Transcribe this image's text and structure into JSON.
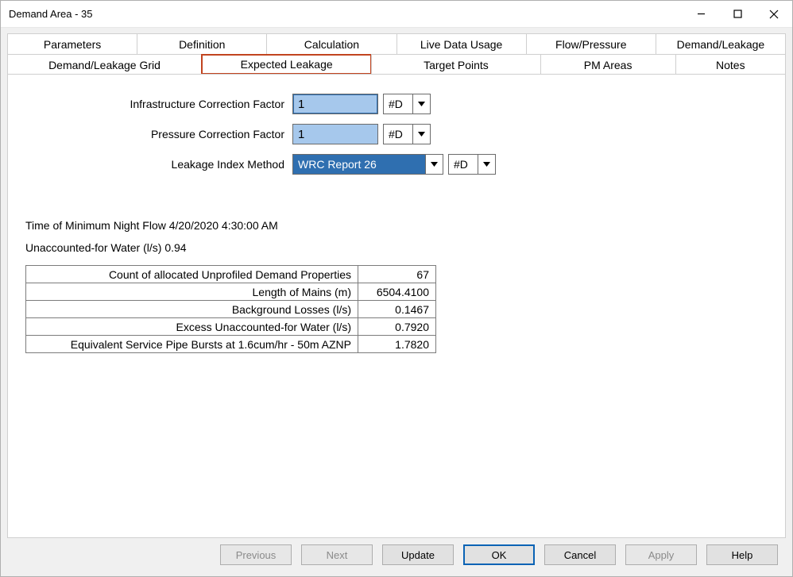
{
  "window": {
    "title": "Demand Area - 35"
  },
  "tabs": {
    "row1": [
      "Parameters",
      "Definition",
      "Calculation",
      "Live Data Usage",
      "Flow/Pressure",
      "Demand/Leakage"
    ],
    "row2": [
      "Demand/Leakage Grid",
      "Expected Leakage",
      "Target Points",
      "PM Areas",
      "Notes"
    ],
    "active": "Expected Leakage"
  },
  "form": {
    "icf": {
      "label": "Infrastructure Correction Factor",
      "value": "1",
      "flag": "#D"
    },
    "pcf": {
      "label": "Pressure Correction Factor",
      "value": "1",
      "flag": "#D"
    },
    "lim": {
      "label": "Leakage Index Method",
      "value": "WRC Report 26",
      "flag": "#D"
    }
  },
  "info": {
    "min_night_flow_label": "Time of Minimum Night Flow",
    "min_night_flow_value": "4/20/2020 4:30:00 AM",
    "unaccounted_label": "Unaccounted-for Water (l/s)",
    "unaccounted_value": "0.94"
  },
  "metrics": [
    {
      "label": "Count of allocated Unprofiled Demand Properties",
      "value": "67"
    },
    {
      "label": "Length of Mains (m)",
      "value": "6504.4100"
    },
    {
      "label": "Background Losses (l/s)",
      "value": "0.1467"
    },
    {
      "label": "Excess Unaccounted-for Water (l/s)",
      "value": "0.7920"
    },
    {
      "label": "Equivalent Service Pipe Bursts at 1.6cum/hr - 50m AZNP",
      "value": "1.7820"
    }
  ],
  "buttons": {
    "previous": "Previous",
    "next": "Next",
    "update": "Update",
    "ok": "OK",
    "cancel": "Cancel",
    "apply": "Apply",
    "help": "Help"
  }
}
